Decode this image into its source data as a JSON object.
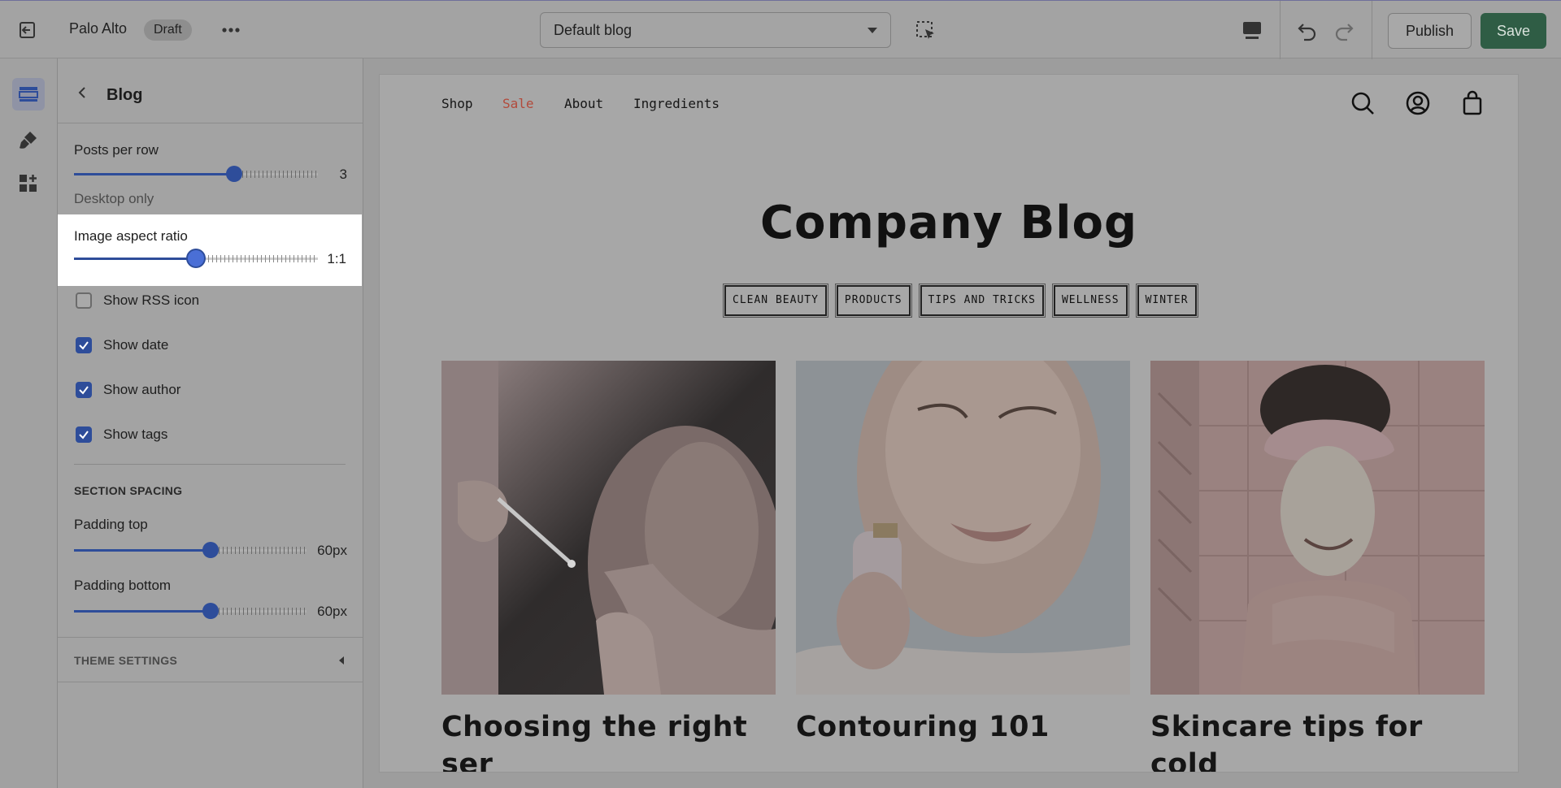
{
  "topbar": {
    "store_name": "Palo Alto",
    "status_badge": "Draft",
    "template_select": "Default blog",
    "publish_label": "Publish",
    "save_label": "Save"
  },
  "rail": {
    "items": [
      {
        "name": "sections-icon",
        "active": true
      },
      {
        "name": "theme-settings-icon",
        "active": false
      },
      {
        "name": "apps-icon",
        "active": false
      }
    ]
  },
  "panel": {
    "title": "Blog",
    "posts_per_row": {
      "label": "Posts per row",
      "value": "3",
      "sub": "Desktop only"
    },
    "image_aspect_ratio": {
      "label": "Image aspect ratio",
      "value": "1:1"
    },
    "checkboxes": [
      {
        "label": "Show RSS icon",
        "checked": false
      },
      {
        "label": "Show date",
        "checked": true
      },
      {
        "label": "Show author",
        "checked": true
      },
      {
        "label": "Show tags",
        "checked": true
      }
    ],
    "section_spacing": {
      "heading": "SECTION SPACING",
      "padding_top": {
        "label": "Padding top",
        "value": "60px"
      },
      "padding_bottom": {
        "label": "Padding bottom",
        "value": "60px"
      }
    },
    "theme_settings": "THEME SETTINGS"
  },
  "preview": {
    "nav": [
      "Shop",
      "Sale",
      "About",
      "Ingredients"
    ],
    "header_icons": [
      "search-icon",
      "account-icon",
      "cart-icon"
    ],
    "title": "Company Blog",
    "tags": [
      "CLEAN BEAUTY",
      "PRODUCTS",
      "TIPS AND TRICKS",
      "WELLNESS",
      "WINTER"
    ],
    "posts": [
      {
        "title": "Choosing the right ser\num for you"
      },
      {
        "title": "Contouring 101"
      },
      {
        "title": "Skincare tips for cold\nweather"
      }
    ]
  },
  "colors": {
    "accent": "#2e4d9a",
    "save_button": "#2f5d45",
    "sale_link": "#b24a3b"
  }
}
